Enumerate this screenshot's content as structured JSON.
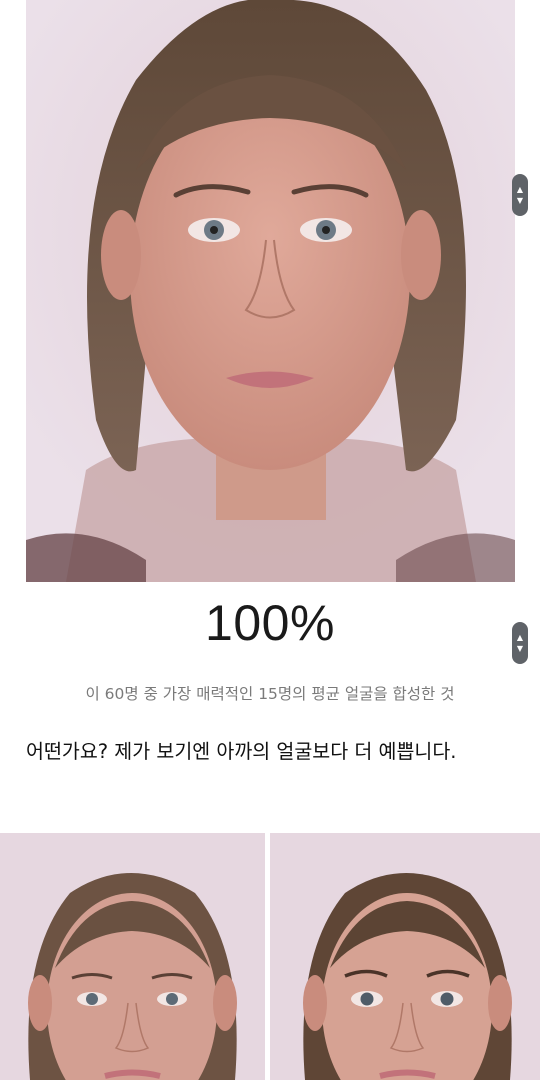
{
  "hero": {
    "alt": "average female face composite"
  },
  "headline": "100%",
  "caption": "이 60명 중 가장 매력적인 15명의 평균 얼굴을 합성한 것",
  "body_text": "어떤가요? 제가 보기엔 아까의 얼굴보다 더 예쁩니다.",
  "icons": {
    "scroll_up": "chevron-up-icon",
    "scroll_down": "chevron-down-icon"
  },
  "colors": {
    "scroll_handle": "#5f6368",
    "text": "#111111",
    "caption": "#7a7a7a"
  }
}
